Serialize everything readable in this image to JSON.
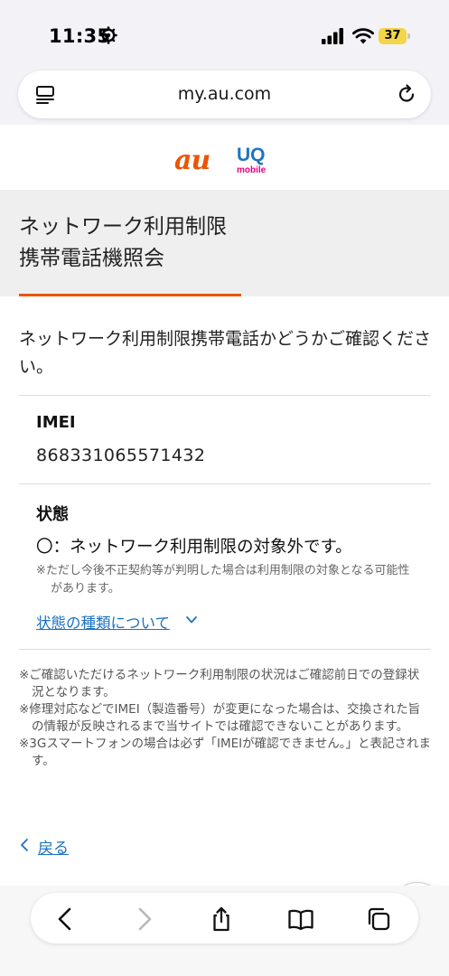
{
  "status_bar": {
    "time": "11:35",
    "battery": "37",
    "battery_color": "#f5d547"
  },
  "browser": {
    "url": "my.au.com"
  },
  "brand": {
    "au_logo": "au",
    "uq_logo": "UQ",
    "uq_sub": "mobile",
    "au_color": "#eb5505",
    "uq_color": "#1d74c2"
  },
  "page": {
    "title_line1": "ネットワーク利用制限",
    "title_line2": "携帯電話機照会",
    "intro": "ネットワーク利用制限携帯電話かどうかご確認ください。",
    "imei_label": "IMEI",
    "imei_value": "868331065571432",
    "status_label": "状態",
    "status_value": "〇：ネットワーク利用制限の対象外です。",
    "status_note": "※ただし今後不正契約等が判明した場合は利用制限の対象となる可能性があります。",
    "status_link": "状態の種類について",
    "notes": [
      "※ご確認いただけるネットワーク利用制限の状況はご確認前日での登録状況となります。",
      "※修理対応などでIMEI（製造番号）が変更になった場合は、交換された旨の情報が反映されるまで当サイトでは確認できないことがあります。",
      "※3Gスマートフォンの場合は必ず「IMEIが確認できません。」と表記されます。"
    ],
    "back_link": "戻る",
    "accent_color": "#eb5505",
    "link_color": "#1b71c2"
  },
  "icons": {
    "status_settings": "gear-icon",
    "tabs": "tabs-icon",
    "reload": "reload-icon",
    "scroll_top": "chevron-up-icon",
    "back": "back-arrow-icon",
    "forward": "forward-arrow-icon",
    "share": "share-icon",
    "bookmarks": "book-icon",
    "tab_overview": "tab-overview-icon"
  }
}
